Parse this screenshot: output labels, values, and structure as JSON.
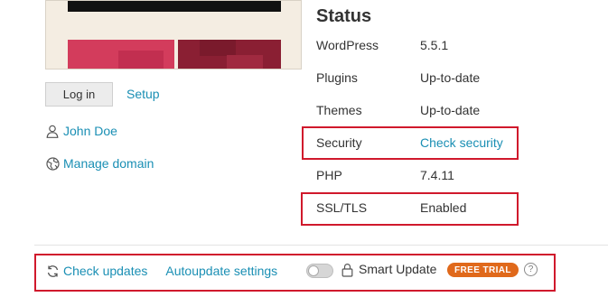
{
  "preview": {
    "login_label": "Log in",
    "setup_label": "Setup"
  },
  "site": {
    "owner": "John Doe",
    "manage_domain": "Manage domain"
  },
  "status": {
    "title": "Status",
    "rows": [
      {
        "label": "WordPress",
        "value": "5.5.1"
      },
      {
        "label": "Plugins",
        "value": "Up-to-date"
      },
      {
        "label": "Themes",
        "value": "Up-to-date"
      },
      {
        "label": "Security",
        "value": "Check security"
      },
      {
        "label": "PHP",
        "value": "7.4.11"
      },
      {
        "label": "SSL/TLS",
        "value": "Enabled"
      }
    ]
  },
  "footer": {
    "check_updates": "Check updates",
    "autoupdate_settings": "Autoupdate settings",
    "smart_update_label": "Smart Update",
    "smart_update_enabled": false,
    "trial_badge": "FREE TRIAL",
    "help_glyph": "?"
  },
  "icons": {
    "user": "user-icon",
    "globe": "globe-icon",
    "refresh": "refresh-icon",
    "lock": "lock-icon",
    "help": "help-icon"
  },
  "colors": {
    "link": "#1a8fb4",
    "highlight": "#d0192c",
    "badge": "#e0691b"
  }
}
